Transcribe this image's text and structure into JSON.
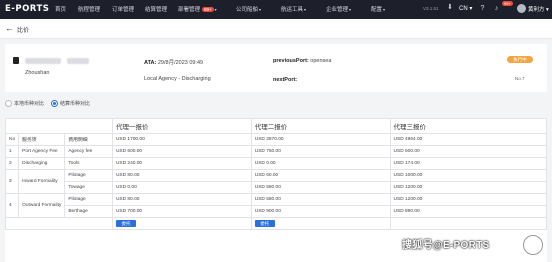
{
  "topbar": {
    "logo": "E-PORTS",
    "nav": [
      {
        "label": "首页"
      },
      {
        "label": "航程管理"
      },
      {
        "label": "订单管理"
      },
      {
        "label": "结算管理"
      },
      {
        "label": "部署管理",
        "badge": "99+",
        "caret": "▾"
      },
      {
        "label": "公司船舶",
        "caret": "▾"
      },
      {
        "label": "航运工具",
        "caret": "▾"
      },
      {
        "label": "企业管理",
        "caret": "▾"
      },
      {
        "label": "配置",
        "caret": "▾"
      }
    ],
    "version": "V3.1.51",
    "language": "CN ▾",
    "notifications": "99+",
    "user": "黄利方 ▾"
  },
  "page": {
    "back": "←",
    "title": "比价"
  },
  "voyage": {
    "port": "Zhoushan",
    "ata_label": "ATA:",
    "ata_value": "29/8月/2023 09:49",
    "agency": "Local Agency - Discharging",
    "previous_port_label": "previousPort:",
    "previous_port_value": "opensea",
    "next_port_label": "nextPort:",
    "next_port_value": "",
    "status": "执行中",
    "status_sub": "No.7"
  },
  "currency_options": [
    {
      "label": "本地币种对比",
      "selected": false
    },
    {
      "label": "结算币种对比",
      "selected": true
    }
  ],
  "table": {
    "group_headers": [
      "代理一报价",
      "代理二报价",
      "代理三报价"
    ],
    "col_no": "No",
    "col_service": "服务项",
    "col_detail": "费用明细",
    "totals": [
      "USD 1700.00",
      "USD 2870.00",
      "USD 4964.00"
    ],
    "groups": [
      {
        "no": "1",
        "service": "Port Agency Fee",
        "rows": [
          {
            "detail": "Agency fee",
            "q": [
              "USD 600.00",
              "USD 750.00",
              "USD 500.00"
            ]
          }
        ]
      },
      {
        "no": "2",
        "service": "Discharging",
        "rows": [
          {
            "detail": "Tools",
            "q": [
              "USD 240.00",
              "USD 0.00",
              "USD 174.00"
            ]
          }
        ]
      },
      {
        "no": "3",
        "service": "Inward Formality",
        "rows": [
          {
            "detail": "Pilotage",
            "q": [
              "USD 80.00",
              "USD 60.00",
              "USD 1000.00"
            ]
          },
          {
            "detail": "Towage",
            "q": [
              "USD 0.00",
              "USD 580.00",
              "USD 1200.00"
            ]
          }
        ]
      },
      {
        "no": "4",
        "service": "Outward Formality",
        "rows": [
          {
            "detail": "Pilotage",
            "q": [
              "USD 80.00",
              "USD 580.00",
              "USD 1200.00"
            ]
          },
          {
            "detail": "Berthage",
            "q": [
              "USD 700.00",
              "USD 900.00",
              "USD 890.00"
            ]
          }
        ]
      }
    ],
    "confirm_label": "委托"
  },
  "watermark": "搜狐号@E-PORTS"
}
